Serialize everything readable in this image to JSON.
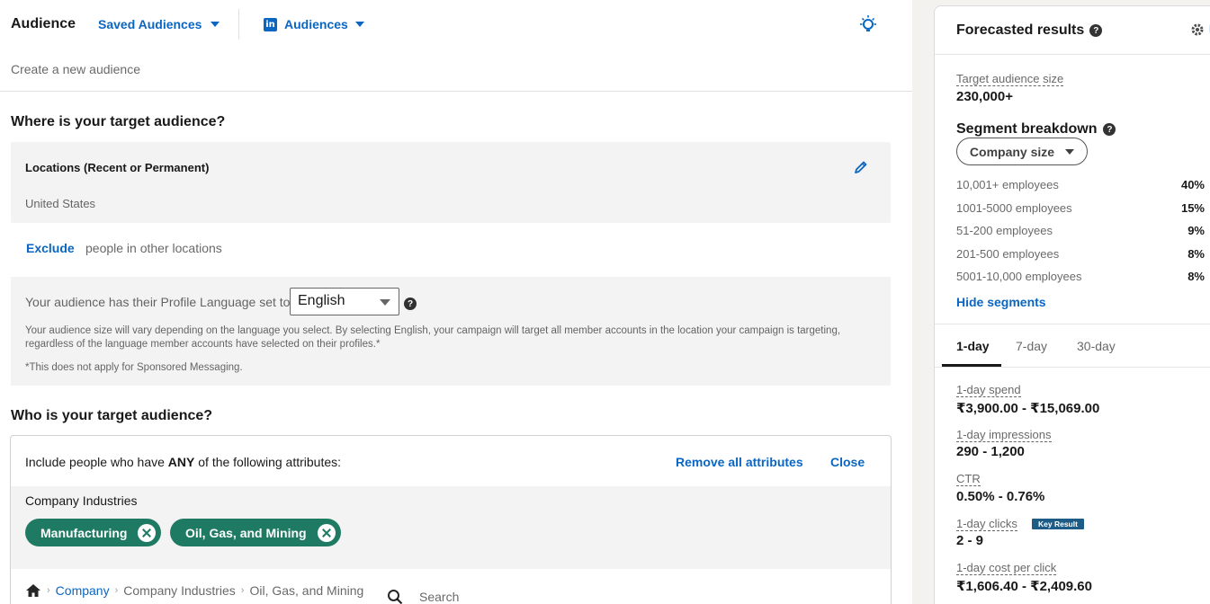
{
  "header": {
    "title": "Audience",
    "saved_audiences": "Saved Audiences",
    "audiences": "Audiences",
    "subtitle": "Create a new audience"
  },
  "where": {
    "heading": "Where is your target audience?",
    "locations_title": "Locations (Recent or Permanent)",
    "locations_value": "United States",
    "exclude_label": "Exclude",
    "exclude_rest": "people in other locations"
  },
  "language": {
    "label": "Your audience has their Profile Language set to",
    "selected": "English",
    "note": "Your audience size will vary depending on the language you select. By selecting English, your campaign will target all member accounts in the location your campaign is targeting, regardless of the language member accounts have selected on their profiles.*",
    "note2": "*This does not apply for Sponsored Messaging."
  },
  "who": {
    "heading": "Who is your target audience?",
    "include_prefix": "Include people who have ",
    "include_any": "ANY",
    "include_suffix": " of the following attributes:",
    "remove_all": "Remove all attributes",
    "close": "Close",
    "industries_label": "Company Industries",
    "pills": [
      "Manufacturing",
      "Oil, Gas, and Mining"
    ],
    "breadcrumb": [
      "Company",
      "Company Industries",
      "Oil, Gas, and Mining"
    ],
    "search_placeholder": "Search"
  },
  "forecast": {
    "title": "Forecasted results",
    "target_size_label": "Target audience size",
    "target_size_value": "230,000+",
    "segment_title": "Segment breakdown",
    "segment_select": "Company size",
    "segments": [
      {
        "label": "10,001+ employees",
        "pct": "40%"
      },
      {
        "label": "1001-5000 employees",
        "pct": "15%"
      },
      {
        "label": "51-200 employees",
        "pct": "9%"
      },
      {
        "label": "201-500 employees",
        "pct": "8%"
      },
      {
        "label": "5001-10,000 employees",
        "pct": "8%"
      }
    ],
    "hide_segments": "Hide segments",
    "tabs": [
      "1-day",
      "7-day",
      "30-day"
    ],
    "metrics": [
      {
        "label": "1-day spend",
        "value": "₹3,900.00 - ₹15,069.00"
      },
      {
        "label": "1-day impressions",
        "value": "290 - 1,200"
      },
      {
        "label": "CTR",
        "value": "0.50% - 0.76%"
      },
      {
        "label": "1-day clicks",
        "value": "2 - 9"
      },
      {
        "label": "1-day cost per click",
        "value": "₹1,606.40 - ₹2,409.60"
      }
    ],
    "key_result": "Key Result"
  },
  "colors": {
    "link": "#0a66c2",
    "pill": "#1f7a63",
    "badge": "#1d5c86"
  }
}
